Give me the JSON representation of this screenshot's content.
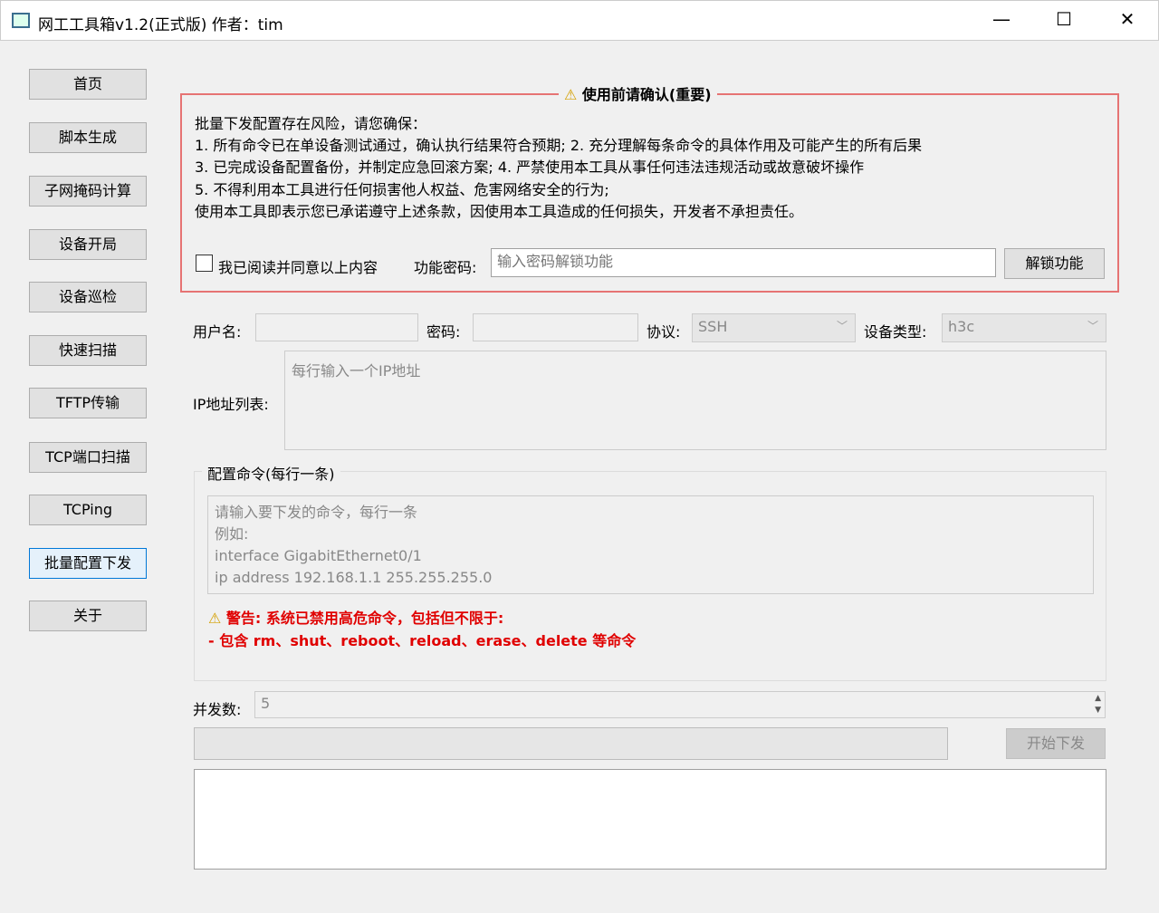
{
  "window": {
    "title": "网工工具箱v1.2(正式版) 作者：tim",
    "minimize": "—",
    "maximize": "☐",
    "close": "✕"
  },
  "sidebar": {
    "items": [
      {
        "label": "首页"
      },
      {
        "label": "脚本生成"
      },
      {
        "label": "子网掩码计算"
      },
      {
        "label": "设备开局"
      },
      {
        "label": "设备巡检"
      },
      {
        "label": "快速扫描"
      },
      {
        "label": "TFTP传输"
      },
      {
        "label": "TCP端口扫描"
      },
      {
        "label": "TCPing"
      },
      {
        "label": "批量配置下发"
      },
      {
        "label": "关于"
      }
    ],
    "active": "批量配置下发"
  },
  "notice": {
    "title": "使用前请确认(重要)",
    "lines": [
      "批量下发配置存在风险，请您确保：",
      "1. 所有命令已在单设备测试通过，确认执行结果符合预期;  2. 充分理解每条命令的具体作用及可能产生的所有后果",
      "3. 已完成设备配置备份，并制定应急回滚方案;  4. 严禁使用本工具从事任何违法违规活动或故意破坏操作",
      "5. 不得利用本工具进行任何损害他人权益、危害网络安全的行为;",
      "使用本工具即表示您已承诺遵守上述条款，因使用本工具造成的任何损失，开发者不承担责任。"
    ],
    "agree_label": "我已阅读并同意以上内容",
    "password_label": "功能密码:",
    "password_placeholder": "输入密码解锁功能",
    "unlock_button": "解锁功能"
  },
  "form": {
    "username_label": "用户名:",
    "password_label": "密码:",
    "protocol_label": "协议:",
    "protocol_value": "SSH",
    "device_type_label": "设备类型:",
    "device_type_value": "h3c",
    "ip_list_label": "IP地址列表:",
    "ip_list_placeholder": "每行输入一个IP地址"
  },
  "commands": {
    "title": "配置命令(每行一条)",
    "placeholder_lines": [
      "请输入要下发的命令，每行一条",
      "例如:",
      "interface GigabitEthernet0/1",
      "ip address 192.168.1.1 255.255.255.0"
    ],
    "warning_1": "警告: 系统已禁用高危命令，包括但不限于:",
    "warning_2": "- 包含 rm、shut、reboot、reload、erase、delete 等命令"
  },
  "concurrency": {
    "label": "并发数:",
    "value": "5"
  },
  "start_button": "开始下发",
  "colors": {
    "warning_red": "#e00000",
    "notice_border": "#e67373",
    "active_border": "#0078d7"
  }
}
